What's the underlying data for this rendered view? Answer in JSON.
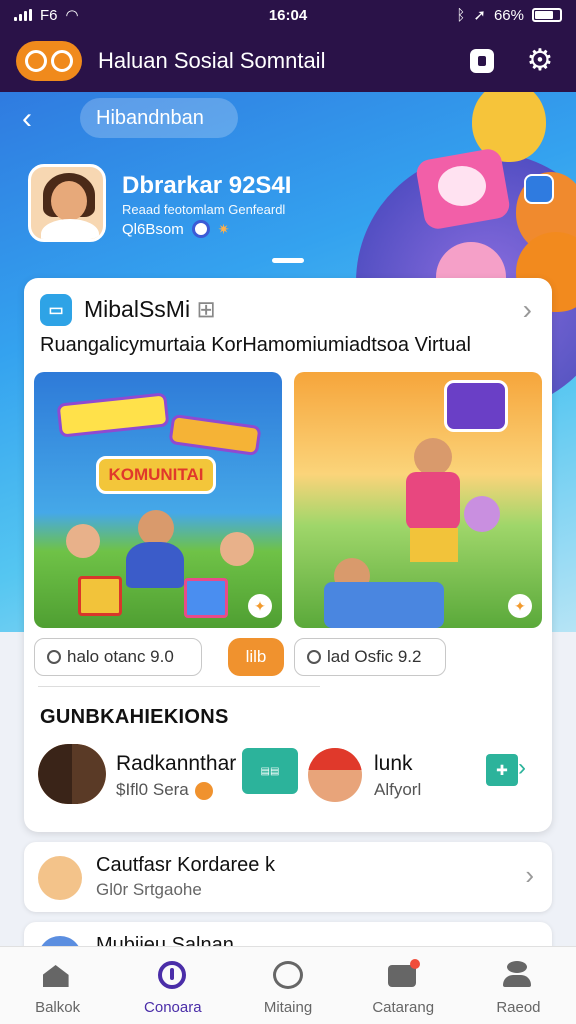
{
  "status_bar": {
    "carrier": "F6",
    "time": "16:04",
    "battery": "66%"
  },
  "app_bar": {
    "title": "Haluan Sosial Somntail",
    "camera_icon": "camera-icon",
    "settings_icon": "gear-icon"
  },
  "hero": {
    "back_icon": "chevron-left-icon",
    "search_label": "Hibandnban",
    "profile_name": "Dbrarkar 92S4I",
    "profile_subtitle": "Reaad feotomlam Genfeardl",
    "profile_stat": "Ql6Bsom"
  },
  "feature_card": {
    "title": "MibalSsMi",
    "subtitle": "Ruangalicymurtaia KorHamomiumiadtsoa Virtual",
    "tile1_banner": "KOMUNITAI",
    "pill_a": "halo otanc 9.0",
    "pill_b": "lilb",
    "pill_c": "lad Osfic 9.2"
  },
  "connections": {
    "heading": "GUNBKAHIEKIONS",
    "items": [
      {
        "name": "Radkannthar",
        "sub": "$Ifl0 Sera"
      },
      {
        "name": "lunk",
        "sub": "Alfyorl"
      }
    ]
  },
  "list": [
    {
      "title": "Cautfasr Kordaree k",
      "sub": "Gl0r Srtgaohe"
    },
    {
      "title": "Mubijeu Salnan",
      "sub": ""
    }
  ],
  "nav": [
    {
      "label": "Balkok",
      "icon": "home-icon"
    },
    {
      "label": "Conoara",
      "icon": "compass-icon"
    },
    {
      "label": "Mitaing",
      "icon": "cloud-icon"
    },
    {
      "label": "Catarang",
      "icon": "message-icon"
    },
    {
      "label": "Raeod",
      "icon": "people-icon"
    }
  ],
  "colors": {
    "header_bg": "#2a1248",
    "accent": "#f0922e",
    "active_nav": "#4a2da8",
    "teal": "#2cb39b"
  }
}
